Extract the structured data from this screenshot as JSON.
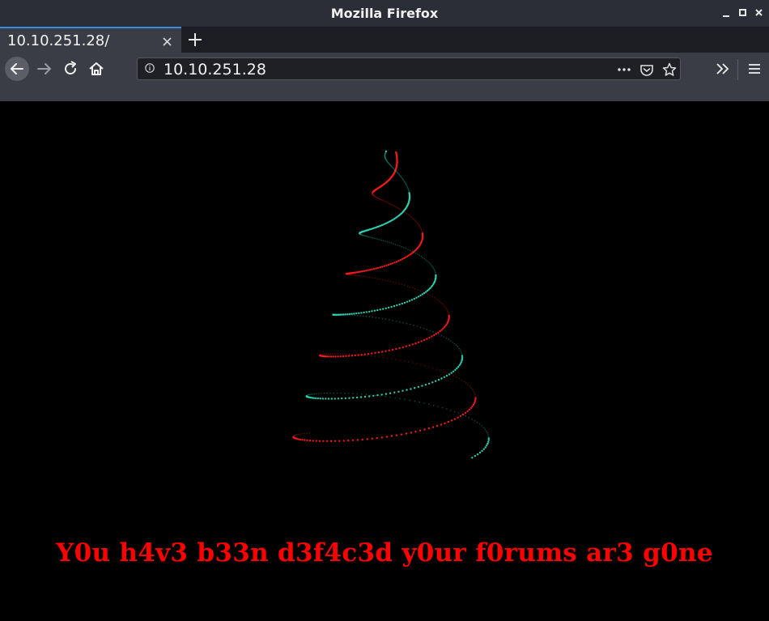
{
  "window": {
    "title": "Mozilla Firefox"
  },
  "tabs": [
    {
      "label": "10.10.251.28/",
      "active": true
    }
  ],
  "navbar": {
    "url": "10.10.251.28"
  },
  "page": {
    "message": "Y0u h4v3 b33n d3f4c3d y0ur f0rums ar3 g0ne",
    "message_color": "#ff0000",
    "background": "#000000",
    "tree_colors": [
      "#ff1a1a",
      "#2fd6b8"
    ]
  },
  "icons": {
    "back": "back-arrow-icon",
    "forward": "forward-arrow-icon",
    "reload": "reload-icon",
    "home": "home-icon",
    "info": "info-icon",
    "more": "page-actions-icon",
    "pocket": "pocket-icon",
    "bookmark": "bookmark-star-icon",
    "overflow": "overflow-chevron-icon",
    "menu": "hamburger-menu-icon"
  }
}
